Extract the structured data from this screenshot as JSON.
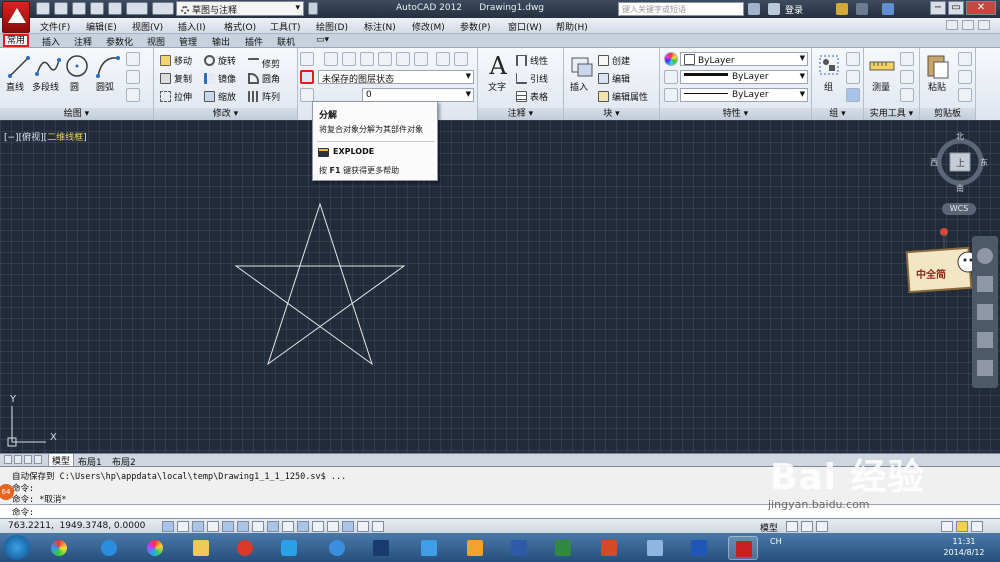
{
  "titlebar": {
    "workspace": "草图与注释",
    "app_title": "AutoCAD 2012",
    "doc_title": "Drawing1.dwg",
    "search_placeholder": "键入关键字或短语",
    "login": "登录"
  },
  "menu": [
    "文件(F)",
    "编辑(E)",
    "视图(V)",
    "插入(I)",
    "格式(O)",
    "工具(T)",
    "绘图(D)",
    "标注(N)",
    "修改(M)",
    "参数(P)",
    "窗口(W)",
    "帮助(H)"
  ],
  "ribbon_tabs": [
    "常用",
    "插入",
    "注释",
    "参数化",
    "视图",
    "管理",
    "输出",
    "插件",
    "联机"
  ],
  "ribbon_tab_extra": "▭▾",
  "ribbon": {
    "draw": {
      "title": "绘图 ▾",
      "line": "直线",
      "polyline": "多段线",
      "circle": "圆",
      "arc": "圆弧"
    },
    "modify": {
      "title": "修改 ▾",
      "move": "移动",
      "rotate": "旋转",
      "trim": "修剪",
      "copy": "复制",
      "mirror": "镜像",
      "fillet": "圆角",
      "stretch": "拉伸",
      "scale": "缩放",
      "array": "阵列"
    },
    "layers": {
      "layer_state": "未保存的图层状态",
      "layer_current": "0"
    },
    "annotation": {
      "title": "注释 ▾",
      "text": "文字",
      "linear": "线性",
      "leader": "引线",
      "table": "表格"
    },
    "block": {
      "title": "块 ▾",
      "insert": "插入",
      "create": "创建",
      "edit": "编辑",
      "edit_attr": "编辑属性"
    },
    "properties": {
      "title": "特性 ▾",
      "color": "ByLayer",
      "linetype": "ByLayer",
      "lineweight": "ByLayer"
    },
    "groups": {
      "title": "组 ▾",
      "group": "组"
    },
    "utilities": {
      "title": "实用工具 ▾",
      "measure": "测量"
    },
    "clipboard": {
      "title": "剪贴板",
      "paste": "粘贴"
    }
  },
  "tooltip": {
    "title": "分解",
    "description": "将复合对象分解为其部件对象",
    "command": "EXPLODE",
    "help_prefix": "按",
    "help_key": "F1",
    "help_suffix": "键获得更多帮助"
  },
  "viewport": {
    "label_prefix": "[−][俯视][",
    "visual_style": "二维线框",
    "label_suffix": "]",
    "viewcube": {
      "north": "北",
      "south": "南",
      "east": "东",
      "west": "西",
      "face": "上"
    },
    "wcs": "WCS",
    "ucs_x": "X",
    "ucs_y": "Y",
    "sticker_text": "中全简"
  },
  "layout_tabs": [
    "模型",
    "布局1",
    "布局2"
  ],
  "command_history": [
    "自动保存到 C:\\Users\\hp\\appdata\\local\\temp\\Drawing1_1_1_1250.sv$ ...",
    "命令:",
    "命令: *取消*"
  ],
  "command_prompt": "命令:",
  "command_badge": "64",
  "status": {
    "coords": "763.2211,  1949.3748, 0.0000",
    "model": "模型"
  },
  "watermark": {
    "brand": "Bai 经验",
    "url": "jingyan.baidu.com"
  },
  "taskbar": {
    "lang": "CH",
    "time": "11:31",
    "date": "2014/8/12"
  },
  "colors": {
    "canvas": "#212b3a",
    "highlight": "#e31b1b",
    "star_stroke": "#e6e6e6"
  }
}
